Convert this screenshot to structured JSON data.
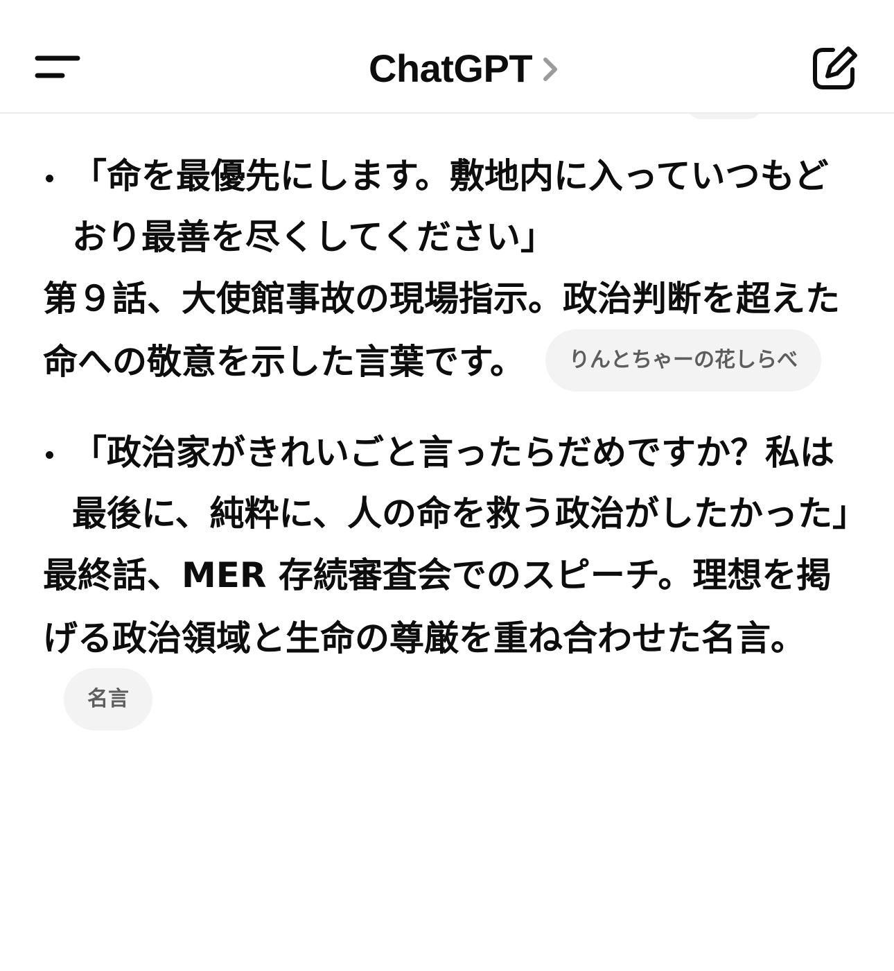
{
  "header": {
    "title": "ChatGPT"
  },
  "response": {
    "items": [
      {
        "quote": "「命を最優先にします。敷地内に入っていつもどおり最善を尽くしてください」",
        "description": "第９話、大使館事故の現場指示。政治判断を超えた命への敬意を示した言葉です。",
        "source_chip": "りんとちゃーの花しらべ"
      },
      {
        "quote": "「政治家がきれいごと言ったらだめですか？私は最後に、純粋に、人の命を救う政治がしたかった」",
        "description": "最終話、MER 存続審査会でのスピーチ。理想を掲げる政治領域と生命の尊厳を重ね合わせた名言。",
        "source_chip": "名言"
      }
    ]
  },
  "icons": {
    "menu": "menu-icon",
    "chevron": "chevron-right-icon",
    "compose": "compose-icon"
  },
  "colors": {
    "text": "#0d0d0d",
    "chip_bg": "#f3f3f3",
    "chip_text": "#5d5d5d",
    "divider": "#ececec",
    "chevron": "#9b9b9b"
  }
}
